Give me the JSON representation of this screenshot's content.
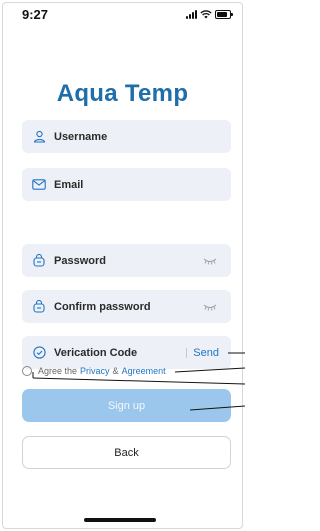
{
  "status": {
    "time": "9:27"
  },
  "app": {
    "title": "Aqua Temp"
  },
  "form": {
    "username": {
      "label": "Username",
      "icon": "user-icon"
    },
    "email": {
      "label": "Email",
      "icon": "mail-icon"
    },
    "password": {
      "label": "Password",
      "icon": "lock-icon"
    },
    "confirm_password": {
      "label": "Confirm password",
      "icon": "lock-icon"
    },
    "verification": {
      "label": "Verication Code",
      "icon": "shield-check-icon",
      "send_label": "Send"
    }
  },
  "agreement": {
    "prefix": "Agree the",
    "privacy": "Privacy",
    "amp": "&",
    "agreement": "Agreement"
  },
  "buttons": {
    "signup": "Sign up",
    "back": "Back"
  },
  "colors": {
    "brand": "#1e6fa9",
    "link": "#1f74c4",
    "field_bg": "#eef0f7",
    "signup_bg": "#9bc7ec"
  }
}
